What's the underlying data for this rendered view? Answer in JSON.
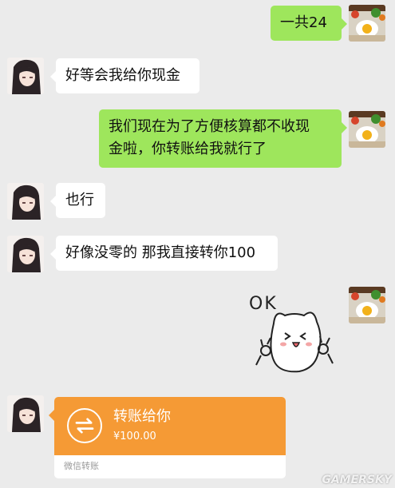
{
  "messages": [
    {
      "side": "out",
      "text": "一共24"
    },
    {
      "side": "in",
      "text": "好等会我给你现金"
    },
    {
      "side": "out",
      "text_line1": "我们现在为了方便核算都不收现",
      "text_line2": "金啦，你转账给我就行了"
    },
    {
      "side": "in",
      "text": "也行"
    },
    {
      "side": "in",
      "text": "好像没零的 那我直接转你100"
    },
    {
      "side": "out",
      "sticker_text": "OK"
    }
  ],
  "transfer": {
    "title": "转账给你",
    "amount": "¥100.00",
    "footer": "微信转账",
    "accent": "#f59a35"
  },
  "watermark": "GAMERSKY",
  "colors": {
    "background": "#ebebeb",
    "out_bubble": "#9ee65c",
    "in_bubble": "#ffffff"
  },
  "icons": {
    "self_avatar": "food-plate-avatar",
    "other_avatar": "anime-girl-avatar",
    "transfer": "transfer-arrows-icon"
  }
}
